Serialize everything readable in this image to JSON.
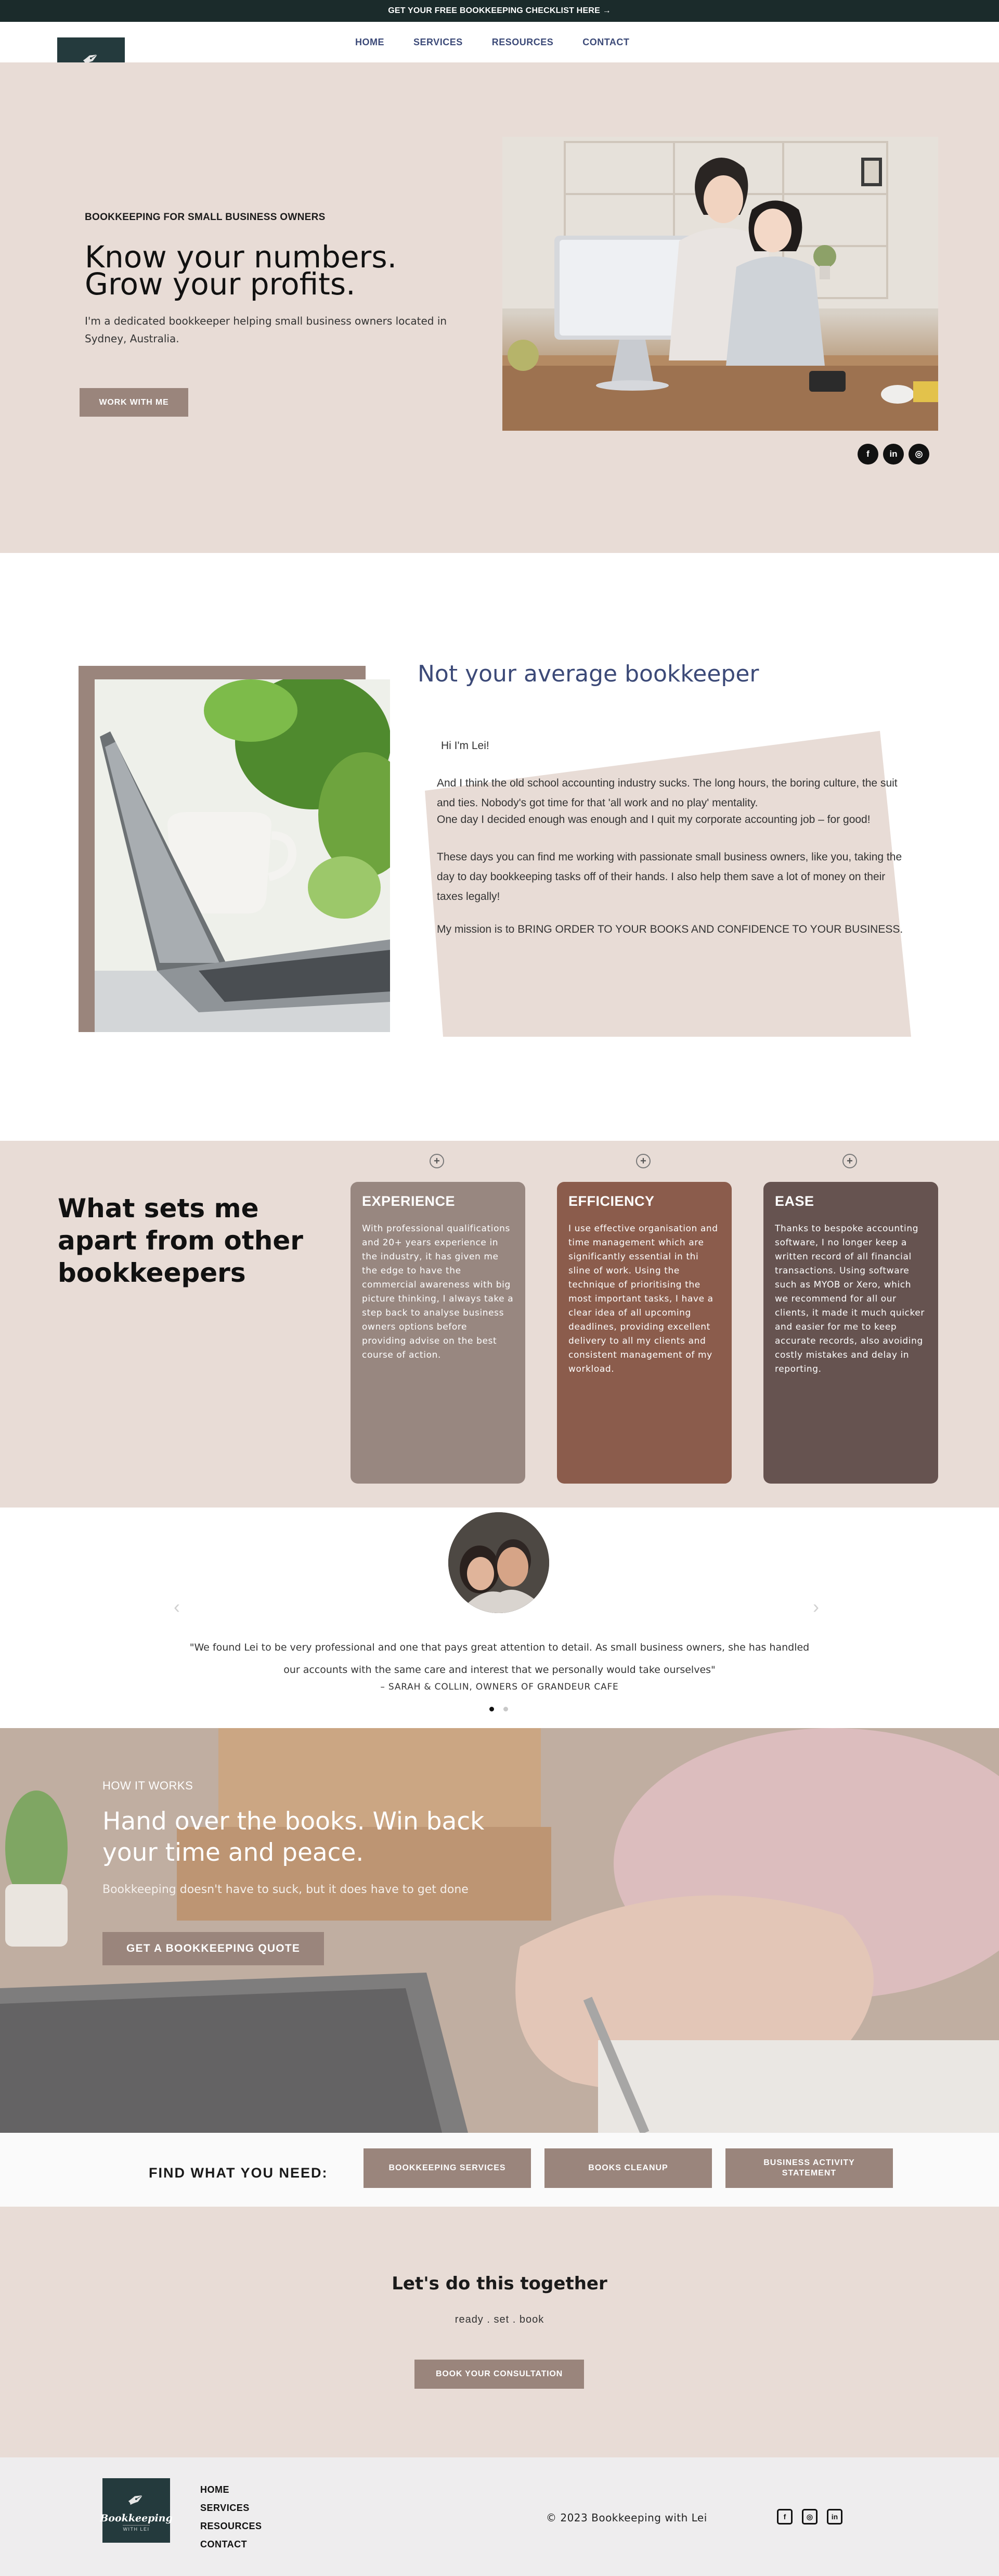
{
  "banner": {
    "text": "GET YOUR FREE BOOKKEEPING CHECKLIST HERE →"
  },
  "logo": {
    "name": "Bookkeeping",
    "sub": "WITH LEI"
  },
  "nav": {
    "items": [
      {
        "label": "HOME"
      },
      {
        "label": "SERVICES"
      },
      {
        "label": "RESOURCES"
      },
      {
        "label": "CONTACT"
      }
    ]
  },
  "hero": {
    "eyebrow": "BOOKKEEPING FOR SMALL BUSINESS OWNERS",
    "headline_1": "Know your numbers.",
    "headline_2": "Grow your profits.",
    "intro": "I'm a dedicated bookkeeper helping small business owners located in Sydney, Australia.",
    "cta": "WORK WITH ME",
    "social": [
      {
        "icon": "facebook-icon",
        "glyph": "f"
      },
      {
        "icon": "linkedin-icon",
        "glyph": "in"
      },
      {
        "icon": "instagram-icon",
        "glyph": "◎"
      }
    ]
  },
  "about": {
    "title": "Not your average bookkeeper",
    "greeting": "Hi I'm Lei!",
    "p1": "And I think the old school accounting industry sucks. The long hours, the boring culture, the suit and ties. Nobody's got time for that 'all work and no play' mentality.",
    "p2": "One day I decided enough was enough and I quit my corporate accounting job – for good!",
    "p3": "These days you can find me working with passionate small business owners, like you, taking the day to day bookkeeping tasks off of their hands. I also help them save a lot of money on their taxes legally!",
    "p4": "My mission is to BRING ORDER TO YOUR BOOKS AND CONFIDENCE TO YOUR BUSINESS."
  },
  "apart": {
    "heading": "What sets me apart from other bookkeepers",
    "cards": [
      {
        "title": "EXPERIENCE",
        "color": "#988780",
        "body": "With professional qualifications and 20+ years experience in the industry, it has given me the edge to have the commercial awareness with big picture thinking, I always take a step back to analyse business owners options before providing advise on the best course of action."
      },
      {
        "title": "EFFICIENCY",
        "color": "#8b5c4c",
        "body": "I use effective organisation and time management which are significantly essential in thi sline of work. Using the technique of prioritising the most important tasks, I have a clear idea of all upcoming deadlines, providing excellent delivery to all my clients and consistent management of my workload."
      },
      {
        "title": "EASE",
        "color": "#665350",
        "body": "Thanks to bespoke accounting software, I no longer keep a written record of all financial transactions. Using software such as MYOB or Xero, which we recommend for all our clients, it made it much quicker and easier for me to keep accurate records, also avoiding costly mistakes and delay in reporting."
      }
    ]
  },
  "testimonial": {
    "quote_1": "\"We found Lei to be very professional and one that pays great attention to detail. As small business owners, she has handled",
    "quote_2": "our accounts with the same care and interest that we personally would take ourselves\"",
    "author": "– SARAH & COLLIN, OWNERS OF GRANDEUR CAFE",
    "prev": "‹",
    "next": "›"
  },
  "how": {
    "eyebrow": "HOW IT WORKS",
    "headline_1": "Hand over the books. Win back",
    "headline_2": "your time and peace.",
    "sub": "Bookkeeping doesn't have to suck,  but it does have to get done",
    "cta": "GET A BOOKKEEPING QUOTE"
  },
  "find": {
    "label": "FIND WHAT YOU NEED:",
    "buttons": [
      {
        "label": "BOOKKEEPING SERVICES"
      },
      {
        "label": "BOOKS CLEANUP"
      },
      {
        "label": "BUSINESS ACTIVITY STATEMENT"
      }
    ]
  },
  "cta": {
    "heading": "Let's do this together",
    "sub": "ready . set . book",
    "button": "BOOK YOUR CONSULTATION"
  },
  "footer": {
    "links": [
      {
        "label": "HOME"
      },
      {
        "label": "SERVICES"
      },
      {
        "label": "RESOURCES"
      },
      {
        "label": "CONTACT"
      }
    ],
    "copyright": "© 2023 Bookkeeping with Lei",
    "social": [
      {
        "icon": "facebook-icon",
        "glyph": "f"
      },
      {
        "icon": "instagram-icon",
        "glyph": "◎"
      },
      {
        "icon": "linkedin-icon",
        "glyph": "in"
      }
    ]
  }
}
